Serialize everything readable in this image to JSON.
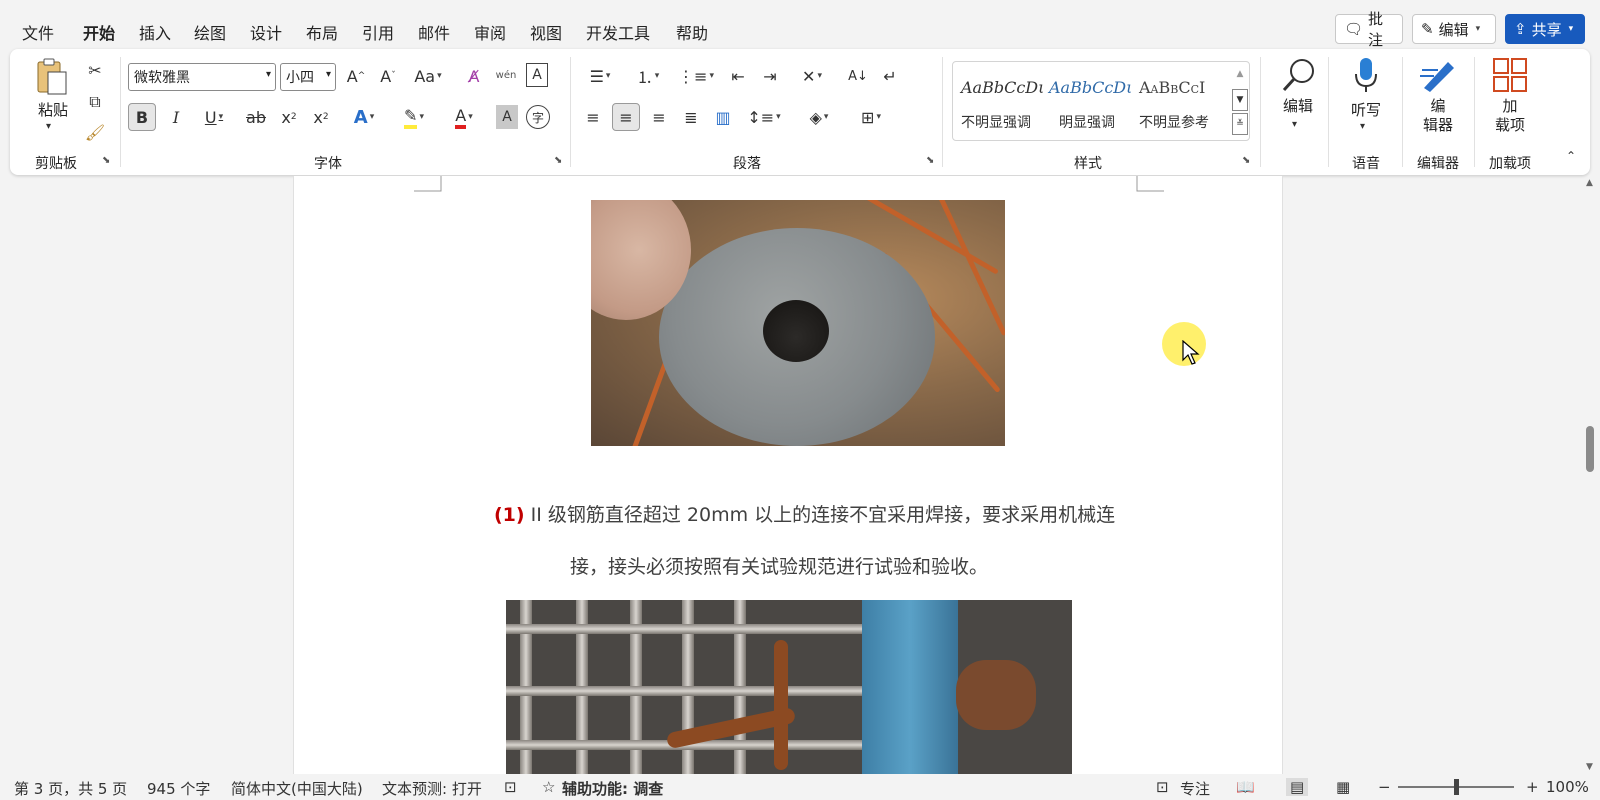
{
  "menu": {
    "tabs": [
      "文件",
      "开始",
      "插入",
      "绘图",
      "设计",
      "布局",
      "引用",
      "邮件",
      "审阅",
      "视图",
      "开发工具",
      "帮助"
    ],
    "active": "开始",
    "comment_btn": "批注",
    "edit_btn": "编辑",
    "share_btn": "共享"
  },
  "ribbon": {
    "clipboard": {
      "paste": "粘贴",
      "label": "剪贴板"
    },
    "font": {
      "name": "微软雅黑",
      "size": "小四",
      "label": "字体"
    },
    "paragraph": {
      "label": "段落"
    },
    "styles": {
      "label": "样式",
      "items": [
        {
          "sample": "AaBbCcDι",
          "name": "不明显强调"
        },
        {
          "sample": "AaBbCcDι",
          "name": "明显强调"
        },
        {
          "sample": "AaBbCcI",
          "name": "不明显参考"
        }
      ]
    },
    "editing": {
      "label": "编辑"
    },
    "voice": {
      "dictate": "听写",
      "label": "语音"
    },
    "editor": {
      "name_line1": "编",
      "name_line2": "辑器",
      "label": "编辑器"
    },
    "addins": {
      "name_line1": "加",
      "name_line2": "载项",
      "label": "加载项"
    }
  },
  "document": {
    "para_num": "(1)",
    "para_line1": "II 级钢筋直径超过 20mm 以上的连接不宜采用焊接，要求采用机械连",
    "para_line2": "接，接头必须按照有关试验规范进行试验和验收。"
  },
  "status": {
    "page": "第 3 页，共 5 页",
    "words": "945 个字",
    "language": "简体中文(中国大陆)",
    "prediction": "文本预测: 打开",
    "accessibility": "辅助功能: 调查",
    "focus": "专注",
    "zoom": "100%",
    "zoom_level": 1.0
  }
}
